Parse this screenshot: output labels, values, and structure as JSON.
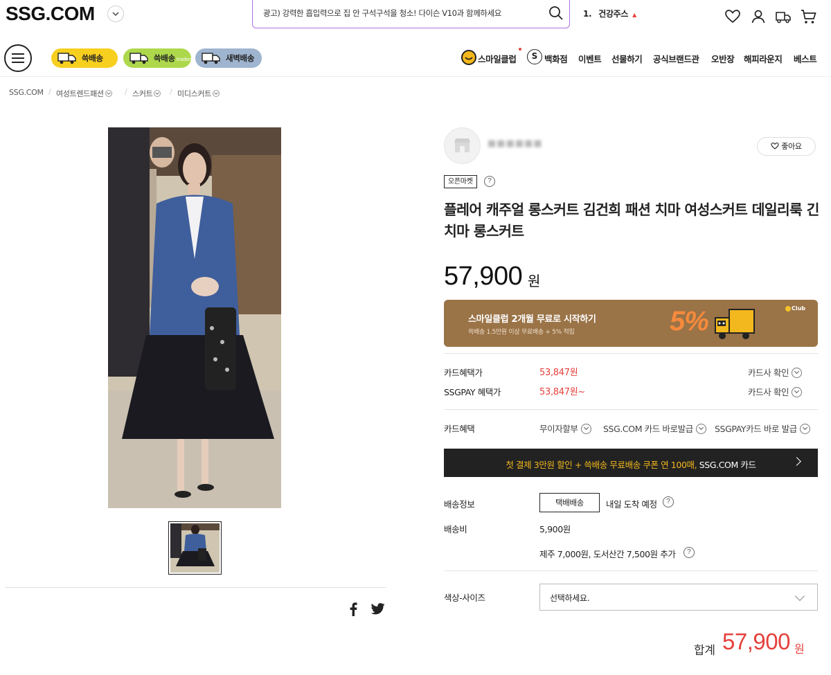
{
  "header": {
    "logo": "SSG.COM",
    "search_placeholder": "광고) 강력한 흡입력으로 집 안 구석구석을 청소! 다이슨 V10과 함께하세요",
    "trend_rank": "1.",
    "trend_keyword": "건강주스",
    "trend_arrow": "▲"
  },
  "delivery_pills": [
    {
      "label": "쓱배송",
      "sub": ""
    },
    {
      "label": "쓱배송",
      "sub": "traders"
    },
    {
      "label": "새벽배송",
      "sub": ""
    }
  ],
  "nav": [
    "스마일클럽",
    "백화점",
    "이벤트",
    "선물하기",
    "공식브랜드관",
    "오반장",
    "해피라운지",
    "베스트"
  ],
  "s_badge": "S",
  "breadcrumb": [
    "SSG.COM",
    "여성트렌드패션",
    "스커트",
    "미디스커트"
  ],
  "store": {
    "name": "■■■■■■",
    "like_label": "좋아요",
    "badge": "오픈마켓"
  },
  "product": {
    "title": "플레어 캐주얼 롱스커트 김건희 패션 치마 여성스커트 데일리룩 긴치마 롱스커트",
    "price": "57,900",
    "currency": "원"
  },
  "banner": {
    "title": "스마일클럽 2개월 무료로 시작하기",
    "subtitle": "쓱배송 1.5만원 이상 무료배송 + 5% 적립",
    "percent": "5%",
    "club": "Club",
    "colors": {
      "background": "#9a7347",
      "accent": "#f68a3c"
    }
  },
  "benefits": [
    {
      "label": "카드혜택가",
      "price": "53,847",
      "unit": "원",
      "action": "카드사 확인"
    },
    {
      "label": "SSGPAY 혜택가",
      "price": "53,847",
      "unit": "원~",
      "action": "카드사 확인"
    }
  ],
  "card_benefits": {
    "label": "카드혜택",
    "options": [
      "무이자할부",
      "SSG.COM 카드 바로발급",
      "SSGPAY카드 바로 발급"
    ]
  },
  "promo": {
    "highlight": "첫 결제 3만원 할인 + 쓱배송 무료배송 쿠폰 연 100매,",
    "rest": " SSG.COM 카드"
  },
  "shipping": {
    "label": "배송정보",
    "method": "택배배송",
    "eta": "내일 도착 예정",
    "fee_label": "배송비",
    "fee": "5,900원",
    "extra": "제주 7,000원, 도서산간 7,500원 추가"
  },
  "option": {
    "label": "색상-사이즈",
    "placeholder": "선택하세요."
  },
  "total": {
    "label": "합계",
    "value": "57,900",
    "unit": "원"
  },
  "colors": {
    "accent_red": "#e5413c",
    "promo_yellow": "#f3b81d",
    "search_border": "#b06ee0"
  }
}
